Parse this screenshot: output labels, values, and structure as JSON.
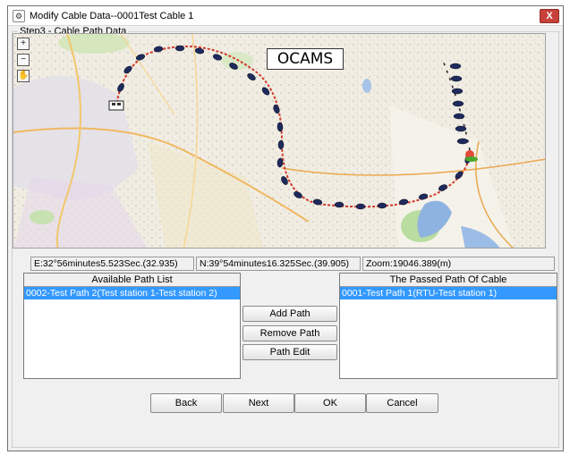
{
  "window": {
    "title": "Modify Cable Data--0001Test Cable 1",
    "close_label": "X"
  },
  "step_title": "Step3 - Cable Path Data",
  "map": {
    "label": "OCAMS",
    "tools": {
      "zoom_in": "+",
      "zoom_out": "−",
      "pan": "✋"
    }
  },
  "status": {
    "east": "E:32°56minutes5.523Sec.(32.935)",
    "north": "N:39°54minutes16.325Sec.(39.905)",
    "zoom": "Zoom:19046.389(m)"
  },
  "available_list": {
    "header": "Available Path List",
    "items": [
      {
        "label": "0002-Test Path 2(Test station 1-Test station 2)",
        "selected": true
      }
    ]
  },
  "passed_list": {
    "header": "The Passed Path Of Cable",
    "items": [
      {
        "label": "0001-Test Path 1(RTU-Test station 1)",
        "selected": true
      }
    ]
  },
  "actions": {
    "add_path": "Add Path",
    "remove_path": "Remove Path",
    "path_edit": "Path Edit"
  },
  "footer": {
    "back": "Back",
    "next": "Next",
    "ok": "OK",
    "cancel": "Cancel"
  },
  "colors": {
    "selection": "#3399ff",
    "close": "#c7413a",
    "route_marker": "#1e2a5c",
    "route_line": "#d23a2a"
  }
}
